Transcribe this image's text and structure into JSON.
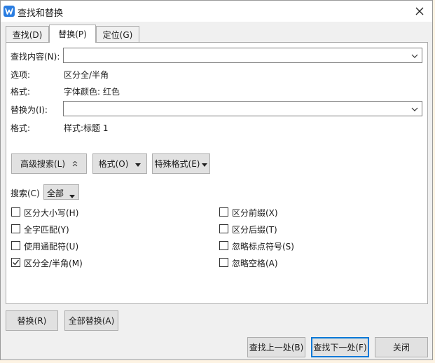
{
  "window": {
    "title": "查找和替换"
  },
  "tabs": [
    {
      "label": "查找(D)"
    },
    {
      "label": "替换(P)"
    },
    {
      "label": "定位(G)"
    }
  ],
  "find": {
    "label": "查找内容(N):",
    "value": "",
    "options_label": "选项:",
    "options_value": "区分全/半角",
    "format_label": "格式:",
    "format_value": "字体颜色: 红色"
  },
  "replace": {
    "label": "替换为(I):",
    "value": "",
    "format_label": "格式:",
    "format_value": "样式:标题 1"
  },
  "toolbar": {
    "advanced_label": "高级搜索(L)",
    "format_label": "格式(O)",
    "special_label": "特殊格式(E)"
  },
  "search": {
    "label": "搜索(C)",
    "selected": "全部"
  },
  "checkboxes": {
    "left": [
      {
        "label": "区分大小写(H)",
        "checked": false
      },
      {
        "label": "全字匹配(Y)",
        "checked": false
      },
      {
        "label": "使用通配符(U)",
        "checked": false
      },
      {
        "label": "区分全/半角(M)",
        "checked": true
      }
    ],
    "right": [
      {
        "label": "区分前缀(X)",
        "checked": false
      },
      {
        "label": "区分后缀(T)",
        "checked": false
      },
      {
        "label": "忽略标点符号(S)",
        "checked": false
      },
      {
        "label": "忽略空格(A)",
        "checked": false
      }
    ]
  },
  "buttons": {
    "replace": "替换(R)",
    "replace_all": "全部替换(A)",
    "find_prev": "查找上一处(B)",
    "find_next": "查找下一处(F)",
    "close": "关闭"
  },
  "colors": {
    "accent": "#0078d7",
    "app_icon": "#2a7de1"
  }
}
